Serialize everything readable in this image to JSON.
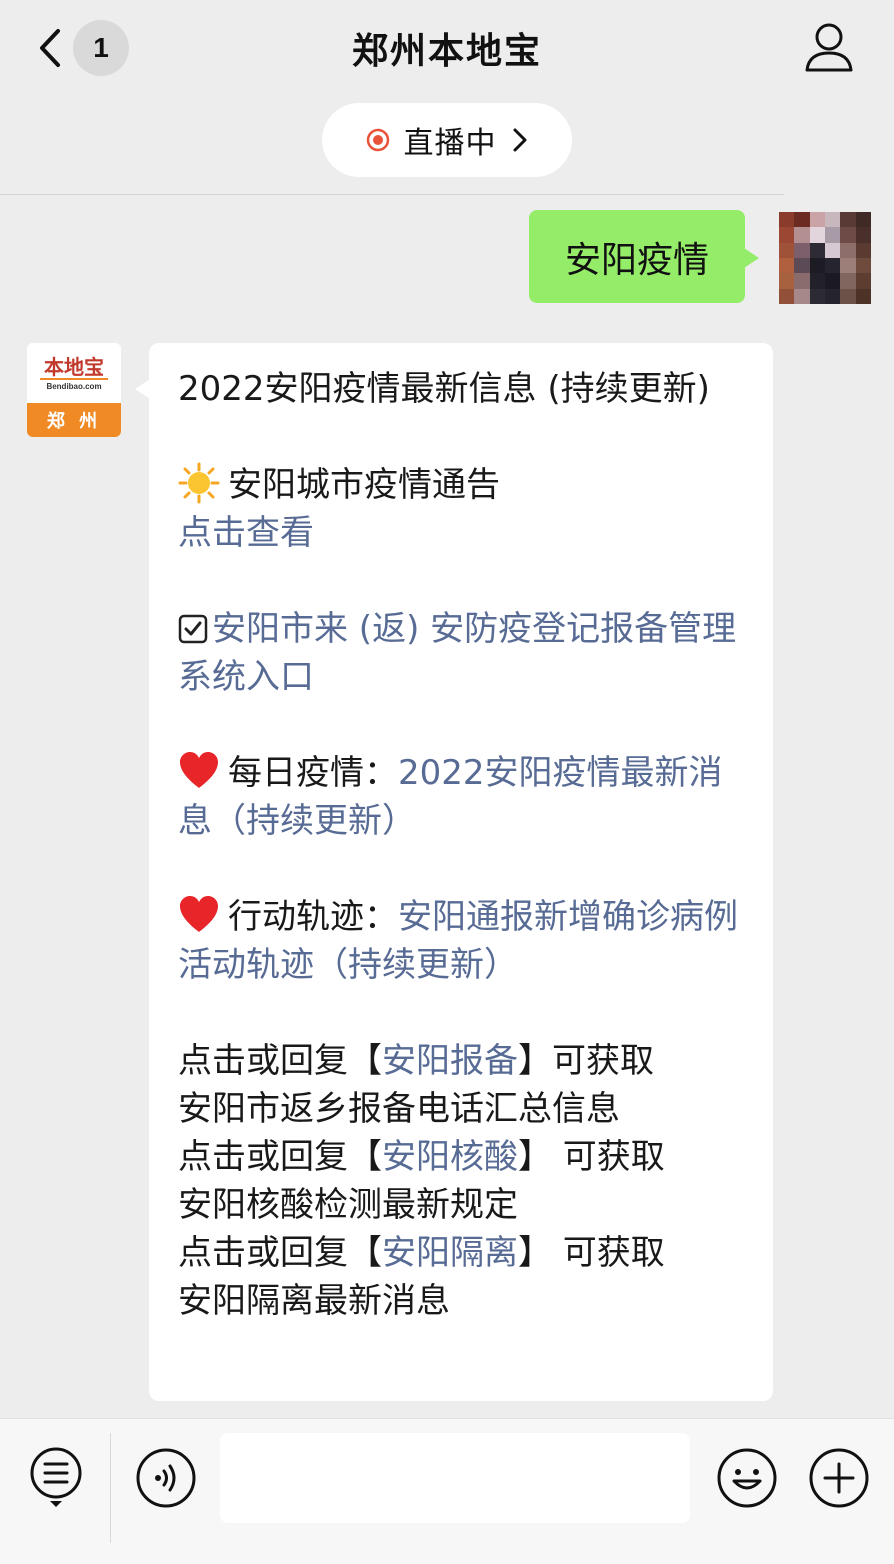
{
  "header": {
    "title": "郑州本地宝",
    "unread_count": "1"
  },
  "live": {
    "label": "直播中"
  },
  "sent_message": {
    "text": "安阳疫情"
  },
  "bot_avatar": {
    "logo_text": "本地宝",
    "logo_url": "Bendibao.com",
    "logo_city": "郑 州"
  },
  "received_message": {
    "headline": "2022安阳疫情最新信息 (持续更新)",
    "notice_label": "安阳城市疫情通告",
    "notice_link": "点击查看",
    "register_link": "安阳市来 (返) 安防疫登记报备管理系统入口",
    "daily_label": "每日疫情：",
    "daily_link": "2022安阳疫情最新消息（持续更新）",
    "track_label": "行动轨迹：",
    "track_link": "安阳通报新增确诊病例活动轨迹（持续更新）",
    "reply_items": [
      {
        "prefix": "点击或回复【",
        "keyword": "安阳报备",
        "suffix": "】可获取",
        "desc": "安阳市返乡报备电话汇总信息"
      },
      {
        "prefix": "点击或回复【",
        "keyword": "安阳核酸",
        "suffix": "】 可获取",
        "desc": "安阳核酸检测最新规定"
      },
      {
        "prefix": "点击或回复【",
        "keyword": "安阳隔离",
        "suffix": "】 可获取",
        "desc": "安阳隔离最新消息"
      }
    ]
  },
  "icons": {
    "back": "chevron-left-icon",
    "profile": "person-icon",
    "live": "record-dot-icon",
    "sun": "sun-icon",
    "check": "checkbox-icon",
    "heart": "heart-icon",
    "menu": "list-menu-icon",
    "voice": "voice-icon",
    "emoji": "smiley-icon",
    "plus": "plus-icon"
  },
  "colors": {
    "background": "#ededed",
    "sent_bubble": "#95ec69",
    "link": "#576b95",
    "live_dot": "#e8533a",
    "brand_orange": "#f08a24"
  }
}
